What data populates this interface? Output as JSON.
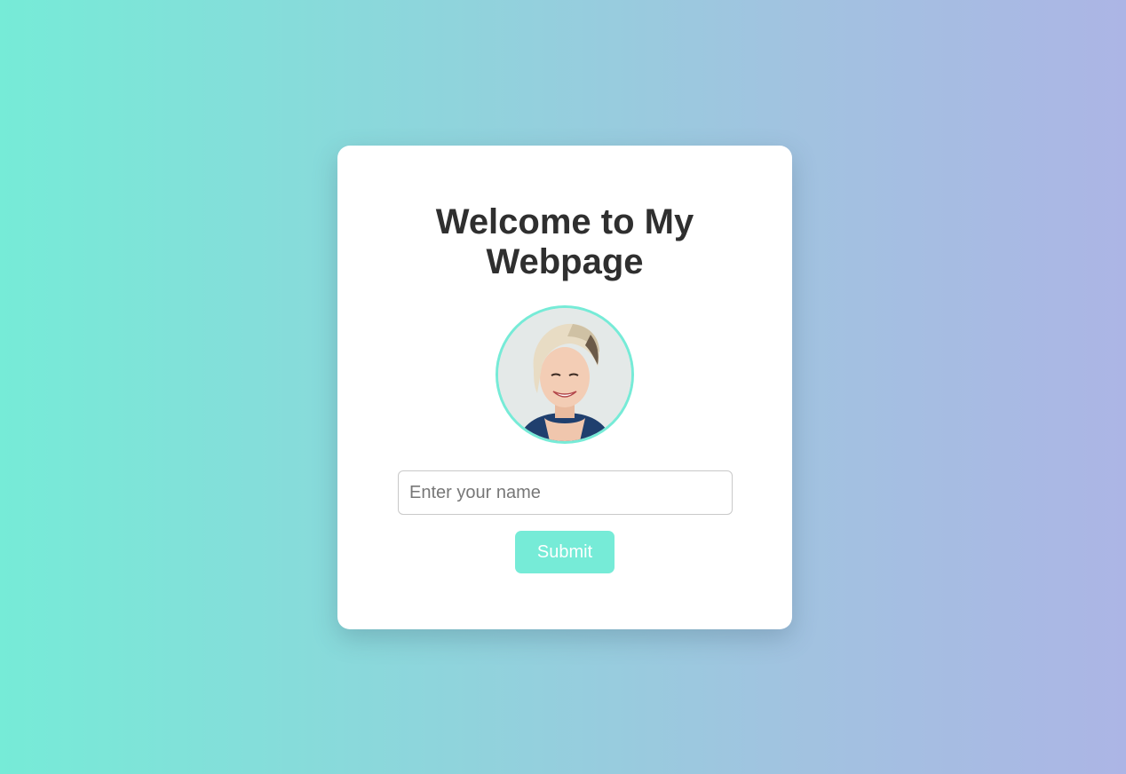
{
  "page": {
    "background_gradient": [
      "#76ebd7",
      "#acb5e5"
    ]
  },
  "card": {
    "title": "Welcome to My Webpage",
    "avatar_icon": "profile-photo",
    "accent_color": "#76ebd7",
    "name_input": {
      "placeholder": "Enter your name",
      "value": ""
    },
    "submit_label": "Submit"
  }
}
